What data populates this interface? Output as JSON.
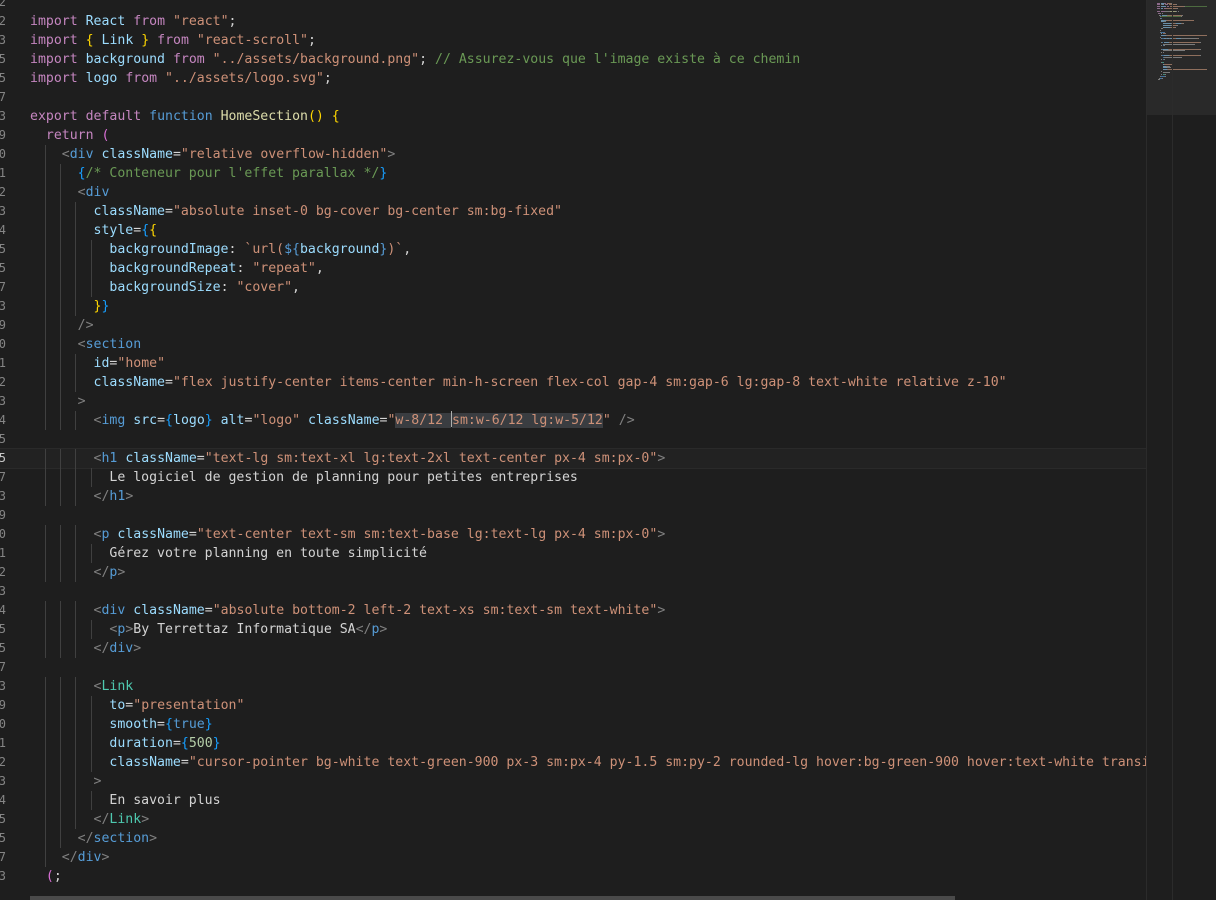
{
  "editor": {
    "active_line": 24,
    "lines": [
      {
        "n": "2",
        "tokens": []
      },
      {
        "n": "2",
        "tokens": [
          [
            "kw",
            "import"
          ],
          [
            "t",
            " "
          ],
          [
            "var",
            "React"
          ],
          [
            "t",
            " "
          ],
          [
            "kw",
            "from"
          ],
          [
            "t",
            " "
          ],
          [
            "str",
            "\"react\""
          ],
          [
            "t",
            ";"
          ]
        ]
      },
      {
        "n": "3",
        "tokens": [
          [
            "kw",
            "import"
          ],
          [
            "t",
            " "
          ],
          [
            "br2",
            "{"
          ],
          [
            "t",
            " "
          ],
          [
            "var",
            "Link"
          ],
          [
            "t",
            " "
          ],
          [
            "br2",
            "}"
          ],
          [
            "t",
            " "
          ],
          [
            "kw",
            "from"
          ],
          [
            "t",
            " "
          ],
          [
            "str",
            "\"react-scroll\""
          ],
          [
            "t",
            ";"
          ]
        ]
      },
      {
        "n": "5",
        "tokens": [
          [
            "kw",
            "import"
          ],
          [
            "t",
            " "
          ],
          [
            "var",
            "background"
          ],
          [
            "t",
            " "
          ],
          [
            "kw",
            "from"
          ],
          [
            "t",
            " "
          ],
          [
            "str",
            "\"../assets/background.png\""
          ],
          [
            "t",
            "; "
          ],
          [
            "com",
            "// Assurez-vous que l'image existe à ce chemin"
          ]
        ]
      },
      {
        "n": "5",
        "tokens": [
          [
            "kw",
            "import"
          ],
          [
            "t",
            " "
          ],
          [
            "var",
            "logo"
          ],
          [
            "t",
            " "
          ],
          [
            "kw",
            "from"
          ],
          [
            "t",
            " "
          ],
          [
            "str",
            "\"../assets/logo.svg\""
          ],
          [
            "t",
            ";"
          ]
        ]
      },
      {
        "n": "7",
        "tokens": []
      },
      {
        "n": "3",
        "tokens": [
          [
            "kw",
            "export"
          ],
          [
            "t",
            " "
          ],
          [
            "kw",
            "default"
          ],
          [
            "t",
            " "
          ],
          [
            "st",
            "function"
          ],
          [
            "t",
            " "
          ],
          [
            "fn",
            "HomeSection"
          ],
          [
            "br2",
            "()"
          ],
          [
            "t",
            " "
          ],
          [
            "br2",
            "{"
          ]
        ]
      },
      {
        "n": "9",
        "tokens": [
          [
            "t",
            "  "
          ],
          [
            "kw",
            "return"
          ],
          [
            "t",
            " "
          ],
          [
            "br",
            "("
          ]
        ]
      },
      {
        "n": "0",
        "tokens": [
          [
            "t",
            "    "
          ],
          [
            "punct",
            "<"
          ],
          [
            "tag",
            "div"
          ],
          [
            "t",
            " "
          ],
          [
            "attr",
            "className"
          ],
          [
            "t",
            "="
          ],
          [
            "str",
            "\"relative overflow-hidden\""
          ],
          [
            "punct",
            ">"
          ]
        ]
      },
      {
        "n": "1",
        "tokens": [
          [
            "t",
            "      "
          ],
          [
            "br3",
            "{"
          ],
          [
            "com",
            "/* Conteneur pour l'effet parallax */"
          ],
          [
            "br3",
            "}"
          ]
        ]
      },
      {
        "n": "2",
        "tokens": [
          [
            "t",
            "      "
          ],
          [
            "punct",
            "<"
          ],
          [
            "tag",
            "div"
          ]
        ]
      },
      {
        "n": "3",
        "tokens": [
          [
            "t",
            "        "
          ],
          [
            "attr",
            "className"
          ],
          [
            "t",
            "="
          ],
          [
            "str",
            "\"absolute inset-0 bg-cover bg-center sm:bg-fixed\""
          ]
        ]
      },
      {
        "n": "4",
        "tokens": [
          [
            "t",
            "        "
          ],
          [
            "attr",
            "style"
          ],
          [
            "t",
            "="
          ],
          [
            "br3",
            "{"
          ],
          [
            "br2",
            "{"
          ]
        ]
      },
      {
        "n": "5",
        "tokens": [
          [
            "t",
            "          "
          ],
          [
            "var",
            "backgroundImage"
          ],
          [
            "t",
            ": "
          ],
          [
            "str",
            "`url("
          ],
          [
            "st",
            "${"
          ],
          [
            "var",
            "background"
          ],
          [
            "st",
            "}"
          ],
          [
            "str",
            ")`"
          ],
          [
            "t",
            ","
          ]
        ]
      },
      {
        "n": "5",
        "tokens": [
          [
            "t",
            "          "
          ],
          [
            "var",
            "backgroundRepeat"
          ],
          [
            "t",
            ": "
          ],
          [
            "str",
            "\"repeat\""
          ],
          [
            "t",
            ","
          ]
        ]
      },
      {
        "n": "7",
        "tokens": [
          [
            "t",
            "          "
          ],
          [
            "var",
            "backgroundSize"
          ],
          [
            "t",
            ": "
          ],
          [
            "str",
            "\"cover\""
          ],
          [
            "t",
            ","
          ]
        ]
      },
      {
        "n": "3",
        "tokens": [
          [
            "t",
            "        "
          ],
          [
            "br2",
            "}"
          ],
          [
            "br3",
            "}"
          ]
        ]
      },
      {
        "n": "9",
        "tokens": [
          [
            "t",
            "      "
          ],
          [
            "punct",
            "/>"
          ]
        ]
      },
      {
        "n": "0",
        "tokens": [
          [
            "t",
            "      "
          ],
          [
            "punct",
            "<"
          ],
          [
            "tag",
            "section"
          ]
        ]
      },
      {
        "n": "1",
        "tokens": [
          [
            "t",
            "        "
          ],
          [
            "attr",
            "id"
          ],
          [
            "t",
            "="
          ],
          [
            "str",
            "\"home\""
          ]
        ]
      },
      {
        "n": "2",
        "tokens": [
          [
            "t",
            "        "
          ],
          [
            "attr",
            "className"
          ],
          [
            "t",
            "="
          ],
          [
            "str",
            "\"flex justify-center items-center min-h-screen flex-col gap-4 sm:gap-6 lg:gap-8 text-white relative z-10\""
          ]
        ]
      },
      {
        "n": "3",
        "tokens": [
          [
            "t",
            "      "
          ],
          [
            "punct",
            ">"
          ]
        ]
      },
      {
        "n": "4",
        "tokens": [
          [
            "t",
            "        "
          ],
          [
            "punct",
            "<"
          ],
          [
            "tag",
            "img"
          ],
          [
            "t",
            " "
          ],
          [
            "attr",
            "src"
          ],
          [
            "t",
            "="
          ],
          [
            "br3",
            "{"
          ],
          [
            "var",
            "logo"
          ],
          [
            "br3",
            "}"
          ],
          [
            "t",
            " "
          ],
          [
            "attr",
            "alt"
          ],
          [
            "t",
            "="
          ],
          [
            "str",
            "\"logo\""
          ],
          [
            "t",
            " "
          ],
          [
            "attr",
            "className"
          ],
          [
            "t",
            "="
          ],
          [
            "str",
            "\""
          ],
          [
            "strsel",
            "w-8/12 "
          ],
          [
            "cursor",
            ""
          ],
          [
            "strsel",
            "sm:w-6/12 lg:w-5/12"
          ],
          [
            "str",
            "\""
          ],
          [
            "t",
            " "
          ],
          [
            "punct",
            "/>"
          ]
        ]
      },
      {
        "n": "5",
        "tokens": []
      },
      {
        "n": "5",
        "tokens": [
          [
            "t",
            "        "
          ],
          [
            "punct",
            "<"
          ],
          [
            "tag",
            "h1"
          ],
          [
            "t",
            " "
          ],
          [
            "attr",
            "className"
          ],
          [
            "t",
            "="
          ],
          [
            "str",
            "\"text-lg sm:text-xl lg:text-2xl text-center px-4 sm:px-0\""
          ],
          [
            "punct",
            ">"
          ]
        ]
      },
      {
        "n": "7",
        "tokens": [
          [
            "t",
            "          Le logiciel de gestion de planning pour petites entreprises"
          ]
        ]
      },
      {
        "n": "3",
        "tokens": [
          [
            "t",
            "        "
          ],
          [
            "punct",
            "</"
          ],
          [
            "tag",
            "h1"
          ],
          [
            "punct",
            ">"
          ]
        ]
      },
      {
        "n": "9",
        "tokens": []
      },
      {
        "n": "0",
        "tokens": [
          [
            "t",
            "        "
          ],
          [
            "punct",
            "<"
          ],
          [
            "tag",
            "p"
          ],
          [
            "t",
            " "
          ],
          [
            "attr",
            "className"
          ],
          [
            "t",
            "="
          ],
          [
            "str",
            "\"text-center text-sm sm:text-base lg:text-lg px-4 sm:px-0\""
          ],
          [
            "punct",
            ">"
          ]
        ]
      },
      {
        "n": "1",
        "tokens": [
          [
            "t",
            "          Gérez votre planning en toute simplicité"
          ]
        ]
      },
      {
        "n": "2",
        "tokens": [
          [
            "t",
            "        "
          ],
          [
            "punct",
            "</"
          ],
          [
            "tag",
            "p"
          ],
          [
            "punct",
            ">"
          ]
        ]
      },
      {
        "n": "3",
        "tokens": []
      },
      {
        "n": "4",
        "tokens": [
          [
            "t",
            "        "
          ],
          [
            "punct",
            "<"
          ],
          [
            "tag",
            "div"
          ],
          [
            "t",
            " "
          ],
          [
            "attr",
            "className"
          ],
          [
            "t",
            "="
          ],
          [
            "str",
            "\"absolute bottom-2 left-2 text-xs sm:text-sm text-white\""
          ],
          [
            "punct",
            ">"
          ]
        ]
      },
      {
        "n": "5",
        "tokens": [
          [
            "t",
            "          "
          ],
          [
            "punct",
            "<"
          ],
          [
            "tag",
            "p"
          ],
          [
            "punct",
            ">"
          ],
          [
            "t",
            "By Terrettaz Informatique SA"
          ],
          [
            "punct",
            "</"
          ],
          [
            "tag",
            "p"
          ],
          [
            "punct",
            ">"
          ]
        ]
      },
      {
        "n": "5",
        "tokens": [
          [
            "t",
            "        "
          ],
          [
            "punct",
            "</"
          ],
          [
            "tag",
            "div"
          ],
          [
            "punct",
            ">"
          ]
        ]
      },
      {
        "n": "7",
        "tokens": []
      },
      {
        "n": "3",
        "tokens": [
          [
            "t",
            "        "
          ],
          [
            "punct",
            "<"
          ],
          [
            "comp",
            "Link"
          ]
        ]
      },
      {
        "n": "9",
        "tokens": [
          [
            "t",
            "          "
          ],
          [
            "attr",
            "to"
          ],
          [
            "t",
            "="
          ],
          [
            "str",
            "\"presentation\""
          ]
        ]
      },
      {
        "n": "0",
        "tokens": [
          [
            "t",
            "          "
          ],
          [
            "attr",
            "smooth"
          ],
          [
            "t",
            "="
          ],
          [
            "br3",
            "{"
          ],
          [
            "st",
            "true"
          ],
          [
            "br3",
            "}"
          ]
        ]
      },
      {
        "n": "1",
        "tokens": [
          [
            "t",
            "          "
          ],
          [
            "attr",
            "duration"
          ],
          [
            "t",
            "="
          ],
          [
            "br3",
            "{"
          ],
          [
            "num",
            "500"
          ],
          [
            "br3",
            "}"
          ]
        ]
      },
      {
        "n": "2",
        "tokens": [
          [
            "t",
            "          "
          ],
          [
            "attr",
            "className"
          ],
          [
            "t",
            "="
          ],
          [
            "str",
            "\"cursor-pointer bg-white text-green-900 px-3 sm:px-4 py-1.5 sm:py-2 rounded-lg hover:bg-green-900 hover:text-white transition"
          ]
        ]
      },
      {
        "n": "3",
        "tokens": [
          [
            "t",
            "        "
          ],
          [
            "punct",
            ">"
          ]
        ]
      },
      {
        "n": "4",
        "tokens": [
          [
            "t",
            "          En savoir plus"
          ]
        ]
      },
      {
        "n": "5",
        "tokens": [
          [
            "t",
            "        "
          ],
          [
            "punct",
            "</"
          ],
          [
            "comp",
            "Link"
          ],
          [
            "punct",
            ">"
          ]
        ]
      },
      {
        "n": "5",
        "tokens": [
          [
            "t",
            "      "
          ],
          [
            "punct",
            "</"
          ],
          [
            "tag",
            "section"
          ],
          [
            "punct",
            ">"
          ]
        ]
      },
      {
        "n": "7",
        "tokens": [
          [
            "t",
            "    "
          ],
          [
            "punct",
            "</"
          ],
          [
            "tag",
            "div"
          ],
          [
            "punct",
            ">"
          ]
        ]
      },
      {
        "n": "3",
        "tokens": [
          [
            "t",
            "  "
          ],
          [
            "br",
            "("
          ],
          [
            "t",
            ";"
          ]
        ]
      }
    ]
  },
  "colors": {
    "background": "#1e1e1e",
    "keyword": "#c586c0",
    "string": "#ce9178",
    "comment": "#6a9955",
    "tag": "#569cd6",
    "attribute": "#9cdcfe",
    "component": "#4ec9b0",
    "function": "#dcdcaa"
  }
}
